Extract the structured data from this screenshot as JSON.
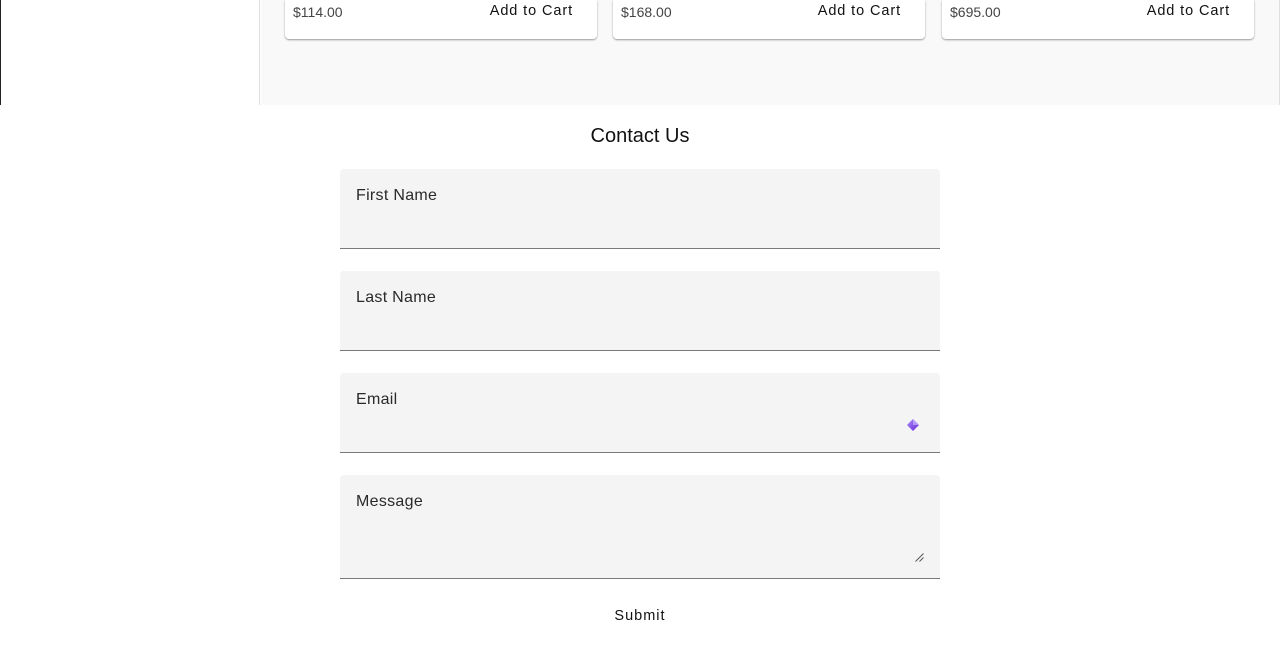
{
  "products": [
    {
      "price": "$114.00",
      "cart_label": "Add to Cart"
    },
    {
      "price": "$168.00",
      "cart_label": "Add to Cart"
    },
    {
      "price": "$695.00",
      "cart_label": "Add to Cart"
    }
  ],
  "contact": {
    "title": "Contact Us",
    "fields": {
      "first_name": {
        "label": "First Name",
        "value": ""
      },
      "last_name": {
        "label": "Last Name",
        "value": ""
      },
      "email": {
        "label": "Email",
        "value": "",
        "extension_icon": "password-manager-icon"
      },
      "message": {
        "label": "Message",
        "value": ""
      }
    },
    "submit_label": "Submit"
  },
  "colors": {
    "panel_bg": "#f9f9f9",
    "field_bg": "#f4f4f4",
    "icon_accent": "#8b5cf6"
  }
}
